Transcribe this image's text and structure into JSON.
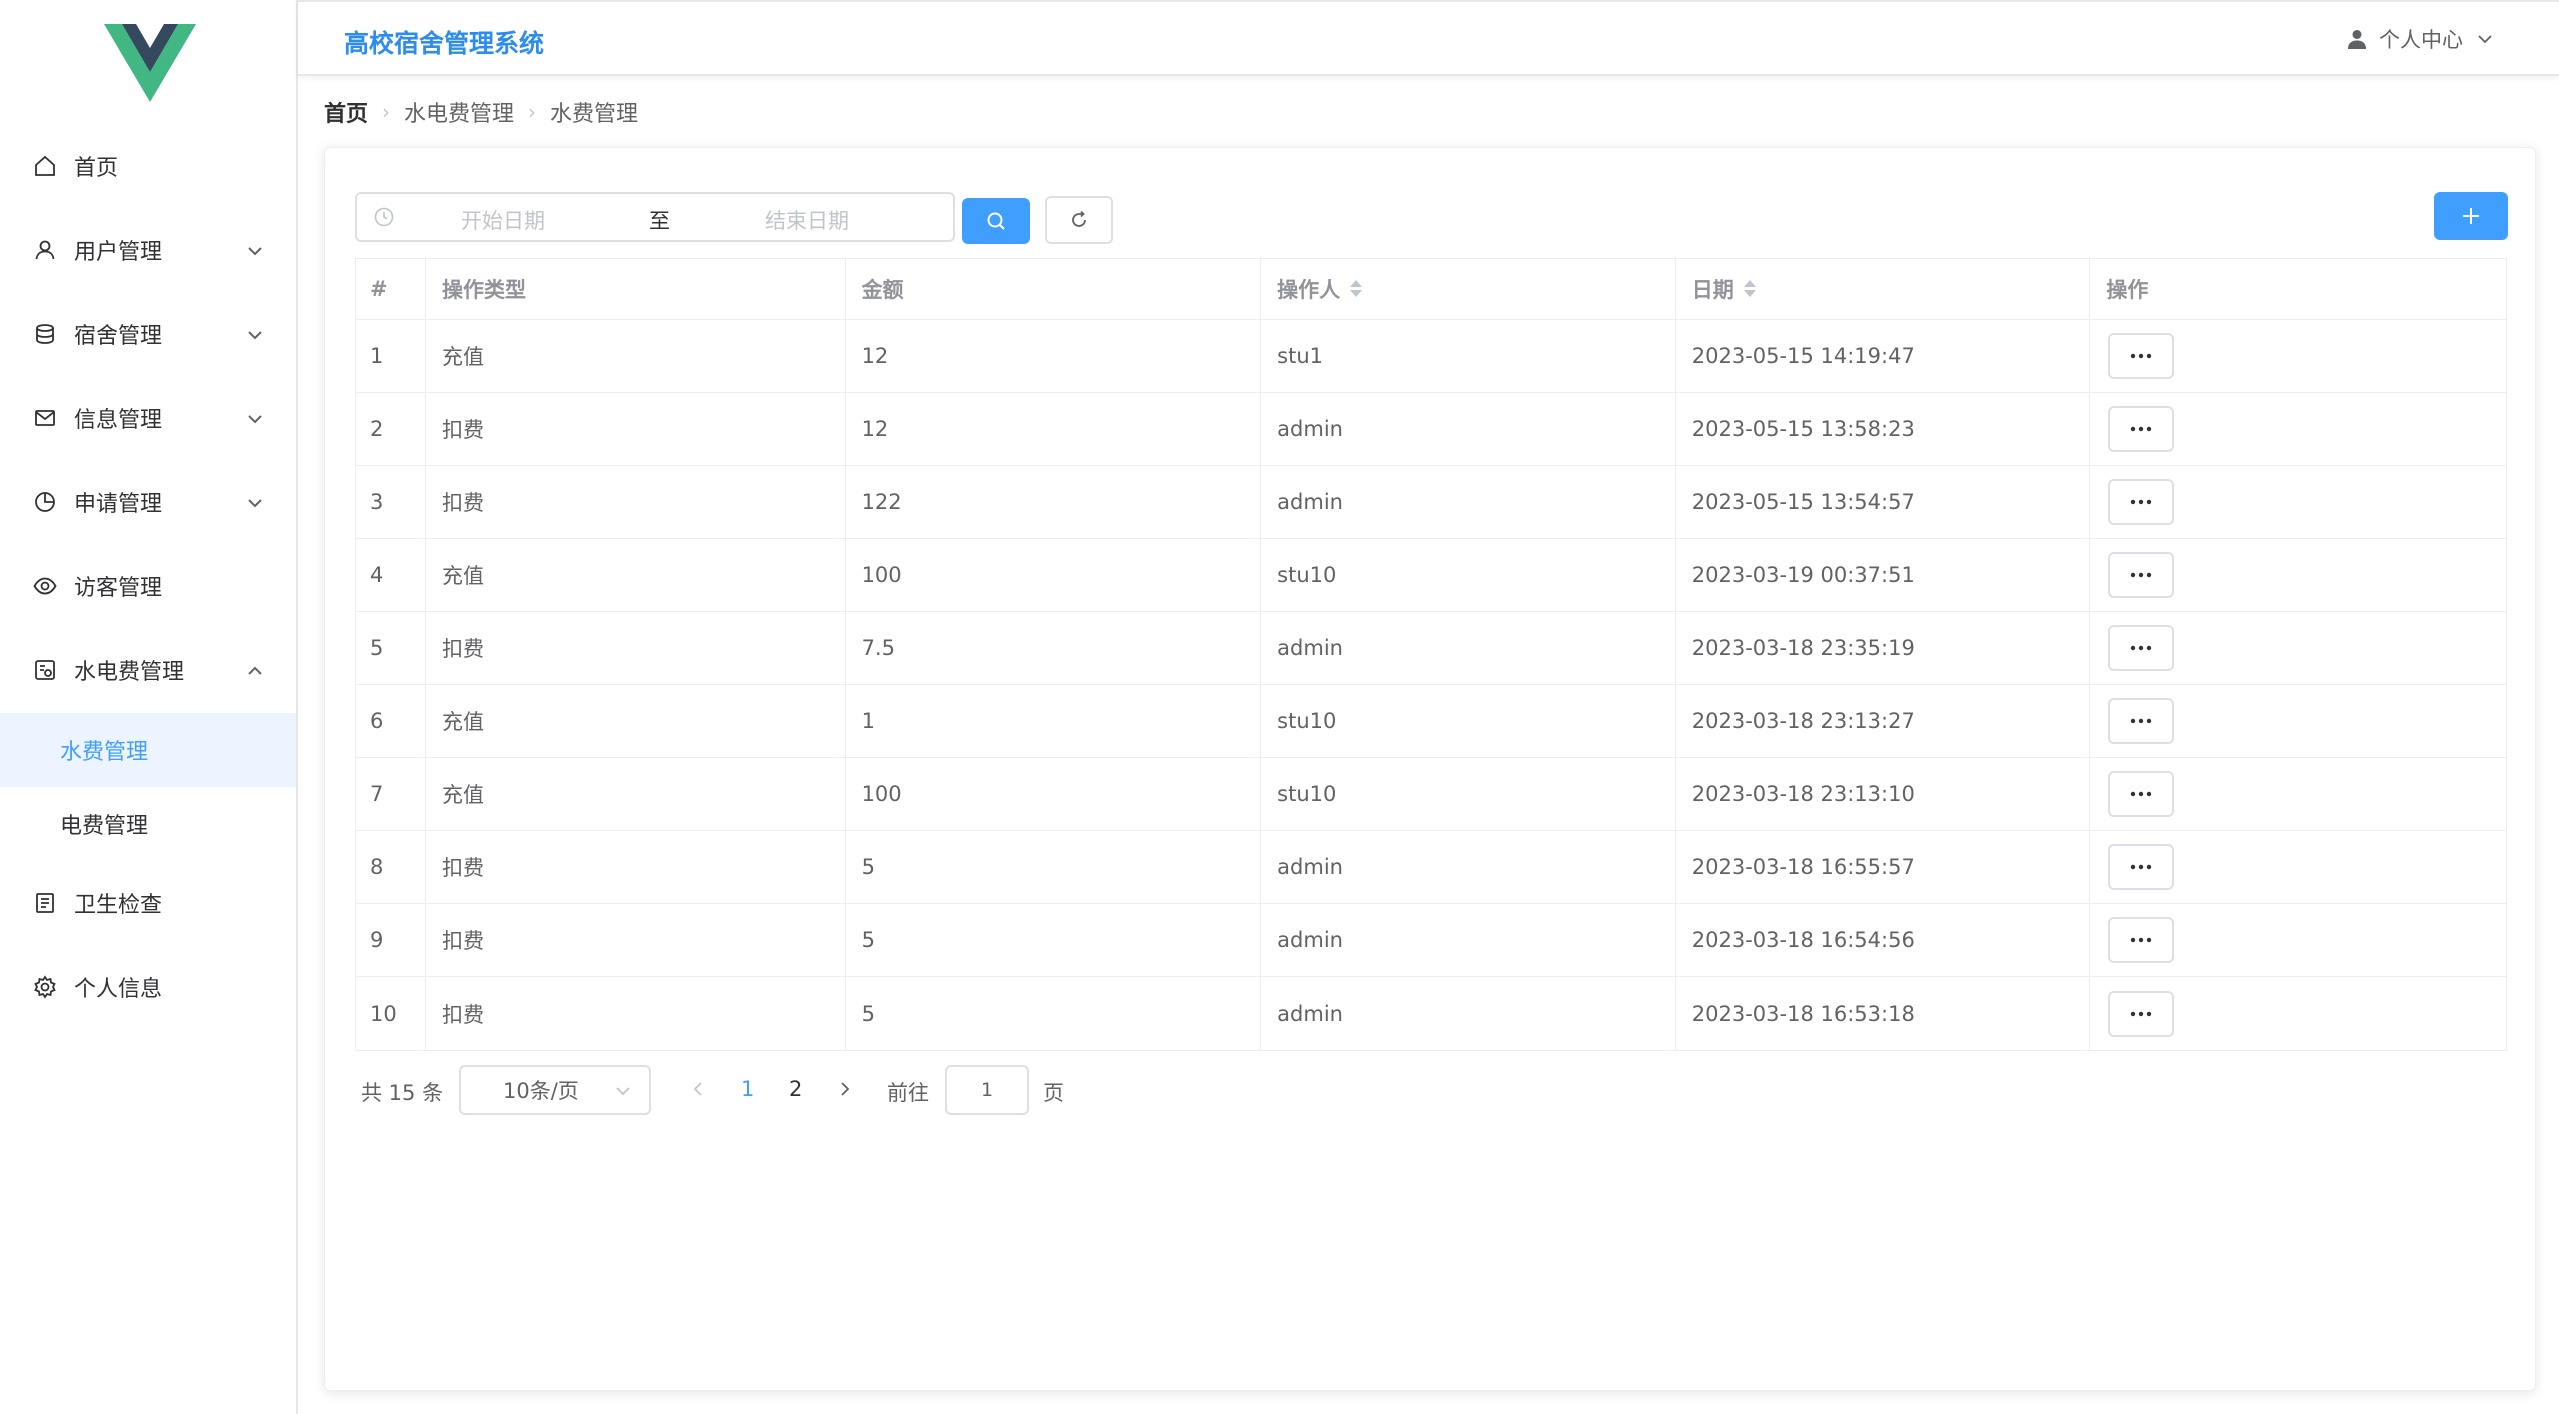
{
  "app": {
    "title": "高校宿舍管理系统",
    "accent": "#409eff",
    "title_color": "#2d8cf0"
  },
  "header": {
    "user_menu_label": "个人中心"
  },
  "sidebar": {
    "items": [
      {
        "label": "首页",
        "icon": "home-icon"
      },
      {
        "label": "用户管理",
        "icon": "user-icon"
      },
      {
        "label": "宿舍管理",
        "icon": "database-icon"
      },
      {
        "label": "信息管理",
        "icon": "mail-icon"
      },
      {
        "label": "申请管理",
        "icon": "pie-chart-icon"
      },
      {
        "label": "访客管理",
        "icon": "eye-icon"
      },
      {
        "label": "水电费管理",
        "icon": "utility-icon"
      },
      {
        "label": "卫生检查",
        "icon": "document-icon"
      },
      {
        "label": "个人信息",
        "icon": "gear-icon"
      }
    ],
    "sub_items": [
      {
        "label": "水费管理",
        "active": true
      },
      {
        "label": "电费管理",
        "active": false
      }
    ]
  },
  "breadcrumb": {
    "home": "首页",
    "level1": "水电费管理",
    "level2": "水费管理"
  },
  "filters": {
    "start_placeholder": "开始日期",
    "separator": "至",
    "end_placeholder": "结束日期"
  },
  "table": {
    "columns": [
      "#",
      "操作类型",
      "金额",
      "操作人",
      "日期",
      "操作"
    ],
    "rows": [
      {
        "index": "1",
        "type": "充值",
        "amount": "12",
        "operator": "stu1",
        "date": "2023-05-15 14:19:47"
      },
      {
        "index": "2",
        "type": "扣费",
        "amount": "12",
        "operator": "admin",
        "date": "2023-05-15 13:58:23"
      },
      {
        "index": "3",
        "type": "扣费",
        "amount": "122",
        "operator": "admin",
        "date": "2023-05-15 13:54:57"
      },
      {
        "index": "4",
        "type": "充值",
        "amount": "100",
        "operator": "stu10",
        "date": "2023-03-19 00:37:51"
      },
      {
        "index": "5",
        "type": "扣费",
        "amount": "7.5",
        "operator": "admin",
        "date": "2023-03-18 23:35:19"
      },
      {
        "index": "6",
        "type": "充值",
        "amount": "1",
        "operator": "stu10",
        "date": "2023-03-18 23:13:27"
      },
      {
        "index": "7",
        "type": "充值",
        "amount": "100",
        "operator": "stu10",
        "date": "2023-03-18 23:13:10"
      },
      {
        "index": "8",
        "type": "扣费",
        "amount": "5",
        "operator": "admin",
        "date": "2023-03-18 16:55:57"
      },
      {
        "index": "9",
        "type": "扣费",
        "amount": "5",
        "operator": "admin",
        "date": "2023-03-18 16:54:56"
      },
      {
        "index": "10",
        "type": "扣费",
        "amount": "5",
        "operator": "admin",
        "date": "2023-03-18 16:53:18"
      }
    ]
  },
  "pagination": {
    "total_text": "共 15 条",
    "page_size": "10条/页",
    "pages": [
      "1",
      "2"
    ],
    "current_page": "1",
    "goto_label": "前往",
    "goto_value": "1",
    "page_suffix": "页"
  }
}
